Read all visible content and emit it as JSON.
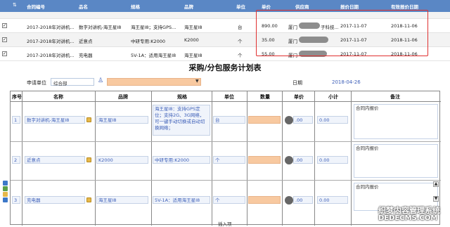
{
  "grid": {
    "columns": [
      "合同编号",
      "品名",
      "规格",
      "品牌",
      "单位",
      "单价",
      "供应商",
      "报价日期",
      "有效报价日期"
    ],
    "rows": [
      {
        "contract": "",
        "name": "",
        "spec": "",
        "brand": "",
        "unit": "",
        "price": "",
        "supplier": "",
        "quote_date": "",
        "valid_date": ""
      },
      {
        "contract": "2017-2018年对讲机...",
        "name": "数字对讲机-海王星I8",
        "spec": "海王星I8；支持GPS...",
        "brand": "海王星I8",
        "unit": "台",
        "price": "890.00",
        "supplier": "厦门",
        "supplier_suffix": "子科技...",
        "quote_date": "2017-11-07",
        "valid_date": "2018-11-06"
      },
      {
        "contract": "2017-2018年对讲机...",
        "name": "近意点",
        "spec": "中研专用:K2000",
        "brand": "K2000",
        "unit": "个",
        "price": "35.00",
        "supplier": "厦门",
        "supplier_suffix": "",
        "quote_date": "2017-11-07",
        "valid_date": "2018-11-06"
      },
      {
        "contract": "2017-2018年对讲机...",
        "name": "充电器",
        "spec": "5V-1A：适用海王星I8",
        "brand": "海王星I8",
        "unit": "个",
        "price": "55.00",
        "supplier": "厦门",
        "supplier_suffix": "",
        "quote_date": "2017-11-07",
        "valid_date": "2018-11-06"
      }
    ]
  },
  "form": {
    "title": "采购/分包服务计划表",
    "apply_unit_label": "申请单位",
    "apply_unit_value": "综合部",
    "date_label": "日期",
    "date_value": "2018-04-26"
  },
  "table": {
    "headers": [
      "序号",
      "名称",
      "品牌",
      "规格",
      "单位",
      "数量",
      "单价",
      "小计",
      "备注"
    ],
    "rows": [
      {
        "no": "1",
        "name": "数字对讲机-海王星I8",
        "brand": "海王星I8",
        "spec": "海王星I8：支持GPS定位；支持2G、3G网络，可一键手动切换或自动切换网络；",
        "unit": "台",
        "qty": "",
        "price": ".00",
        "subtotal": "0.00",
        "remark": "合同内报价"
      },
      {
        "no": "2",
        "name": "近意点",
        "brand": "K2000",
        "spec": "中研专用:K2000",
        "unit": "个",
        "qty": "",
        "price": ".00",
        "subtotal": "0.00",
        "remark": "合同内报价"
      },
      {
        "no": "3",
        "name": "充电器",
        "brand": "海王星I8",
        "spec": "5V-1A：适用海王星I8",
        "unit": "个",
        "qty": "",
        "price": ".00",
        "subtotal": "0.00",
        "remark": "合同内报价"
      }
    ],
    "insert_label": "插入项"
  },
  "watermark": {
    "line1": "织梦内容管理系统",
    "line2": "DEDECMS.COM"
  },
  "colors": {
    "grid_header": "#5a87c5",
    "highlight_border": "#e03030",
    "input_orange": "#f8c9a0",
    "link_blue": "#3d5fb8"
  }
}
